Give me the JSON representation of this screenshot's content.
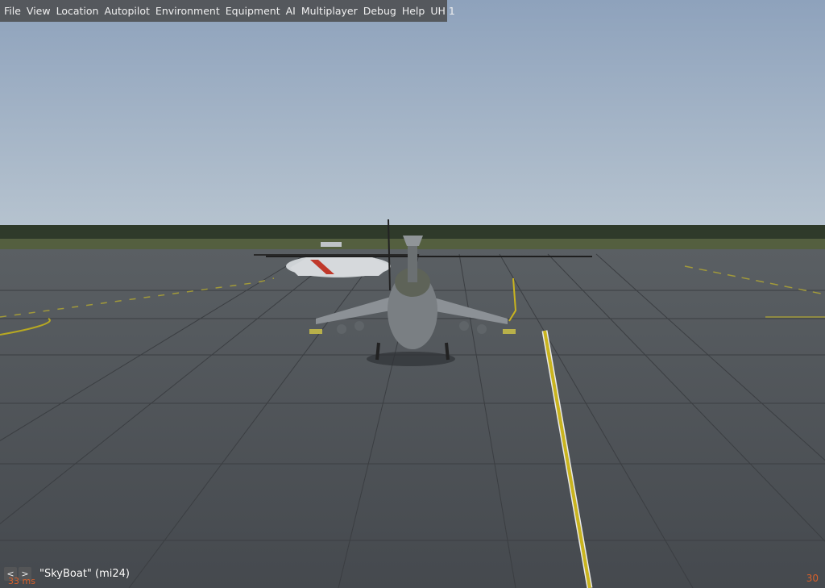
{
  "menubar": {
    "items": [
      "File",
      "View",
      "Location",
      "Autopilot",
      "Environment",
      "Equipment",
      "AI",
      "Multiplayer",
      "Debug",
      "Help",
      "UH 1"
    ]
  },
  "hud": {
    "prev_label": "<",
    "next_label": ">",
    "view_label": "\"SkyBoat\" (mi24)",
    "frame_time": "33 ms",
    "fps": "30"
  },
  "colors": {
    "sky_top": "#8ea2bc",
    "sky_horizon": "#b4c2cf",
    "tarmac": "#474b51",
    "taxi_line": "#c9b41f"
  }
}
